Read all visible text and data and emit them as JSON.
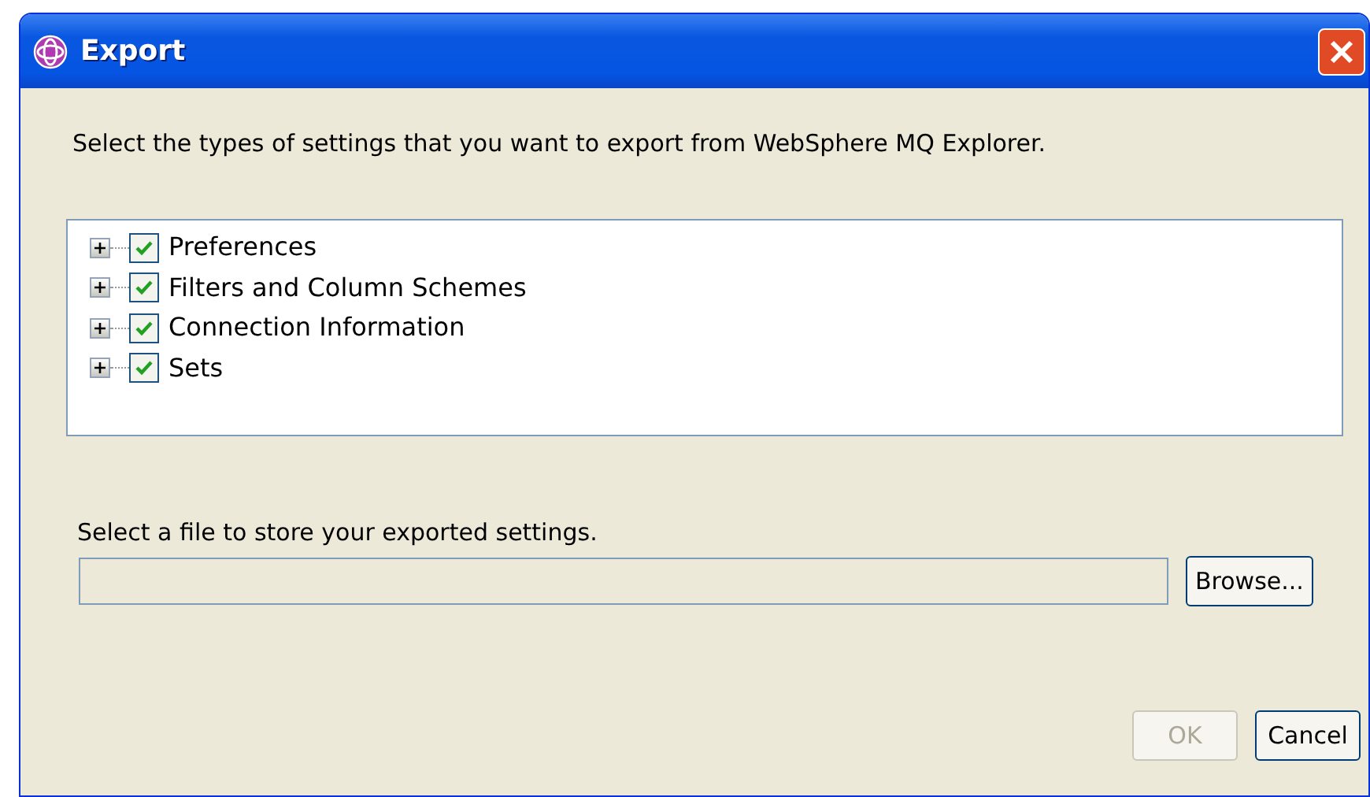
{
  "window": {
    "title": "Export"
  },
  "instruction": "Select the types of settings that you want to export from WebSphere MQ Explorer.",
  "tree": [
    {
      "label": "Preferences",
      "expanded": false,
      "checked": true
    },
    {
      "label": "Filters and Column Schemes",
      "expanded": false,
      "checked": true
    },
    {
      "label": "Connection Information",
      "expanded": false,
      "checked": true
    },
    {
      "label": "Sets",
      "expanded": false,
      "checked": true
    }
  ],
  "file_label": "Select a file to store your exported settings.",
  "browse_button": "Browse...",
  "buttons": [
    {
      "label": "OK",
      "disabled": true
    },
    {
      "label": "Cancel",
      "disabled": false
    }
  ]
}
